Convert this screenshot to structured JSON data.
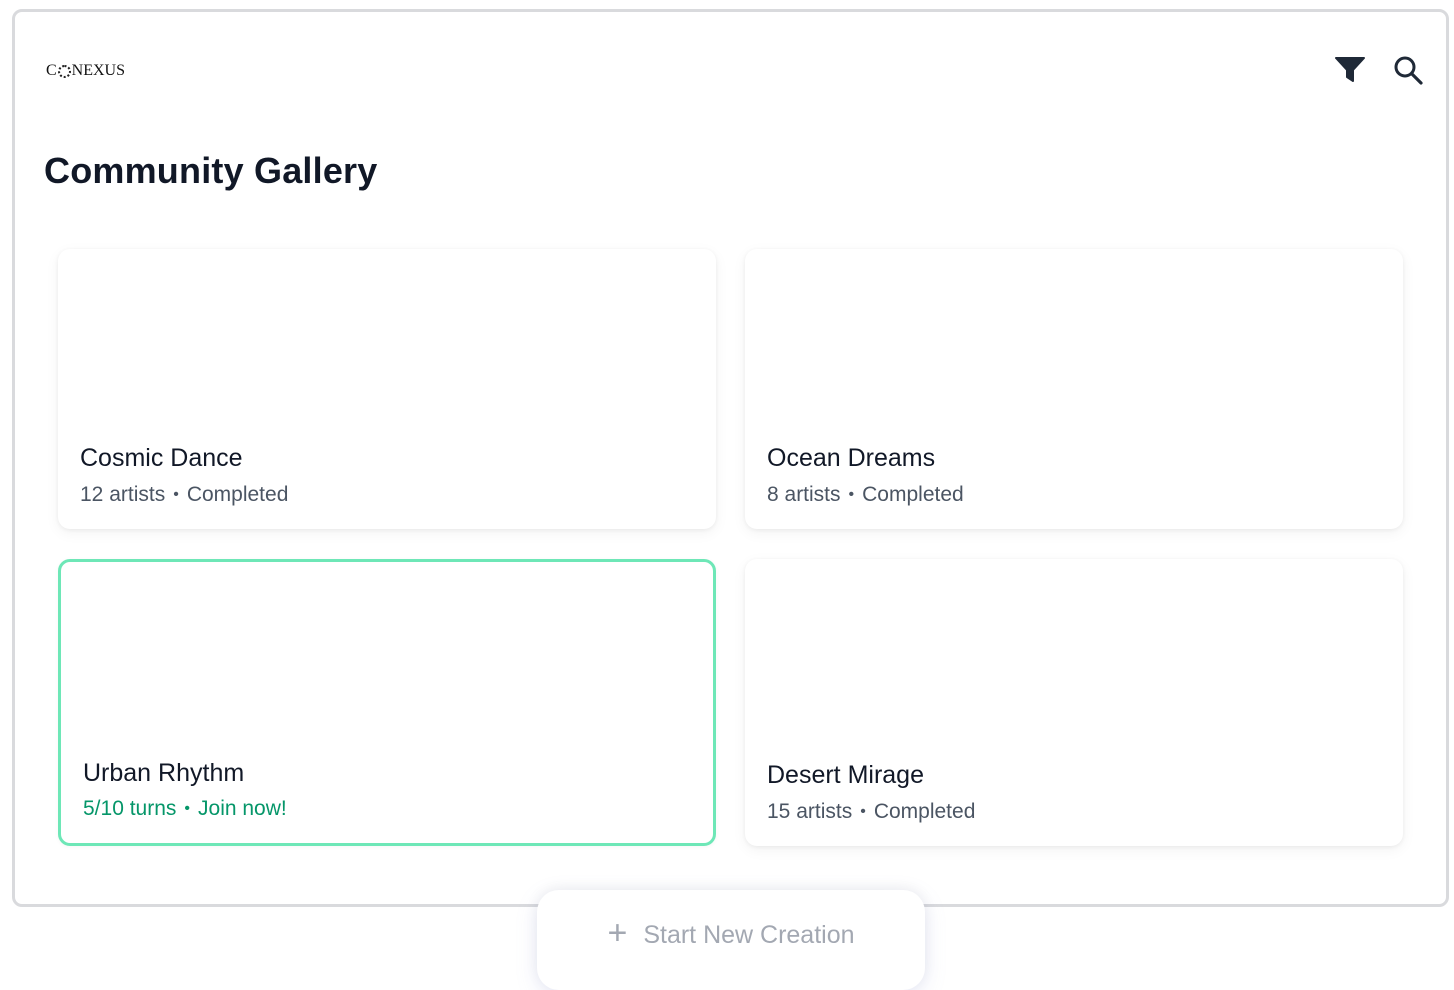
{
  "header": {
    "logo_prefix": "C",
    "logo_suffix": "NEXUS",
    "filter_icon": "filter-icon",
    "search_icon": "search-icon"
  },
  "page": {
    "title": "Community Gallery"
  },
  "cards": [
    {
      "title": "Cosmic Dance",
      "count": "12 artists",
      "status": "Completed"
    },
    {
      "title": "Ocean Dreams",
      "count": "8 artists",
      "status": "Completed"
    },
    {
      "title": "Urban Rhythm",
      "count": "5/10 turns",
      "status": "Join now!"
    },
    {
      "title": "Desert Mirage",
      "count": "15 artists",
      "status": "Completed"
    }
  ],
  "actions": {
    "new_creation_label": "Start New Creation",
    "plus_icon": "plus-icon"
  },
  "colors": {
    "active_border": "#6ee7b7",
    "active_text": "#059669",
    "muted_text": "#4b5563"
  }
}
